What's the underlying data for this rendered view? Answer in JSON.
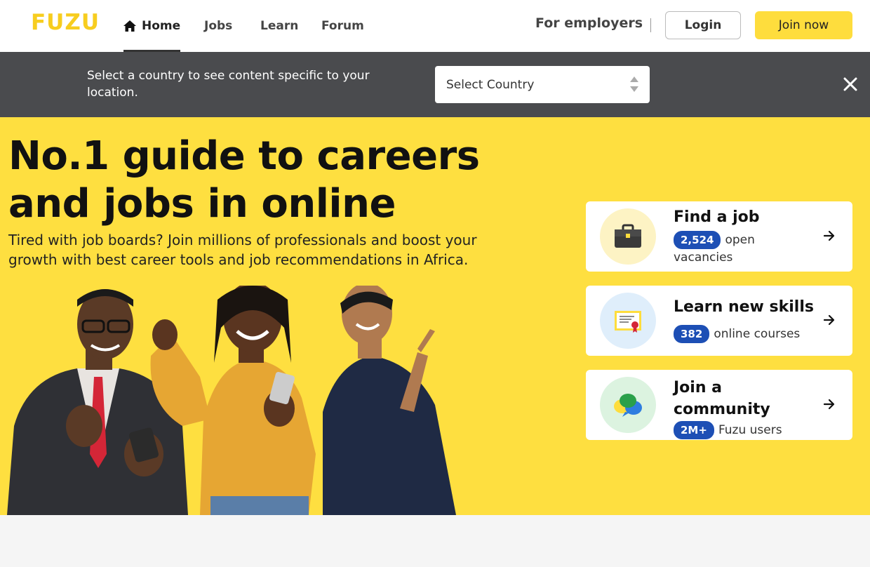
{
  "header": {
    "logo": "FUZU",
    "nav": [
      {
        "label": "Home",
        "active": true
      },
      {
        "label": "Jobs"
      },
      {
        "label": "Learn"
      },
      {
        "label": "Forum"
      }
    ],
    "employers_label": "For employers",
    "login_label": "Login",
    "join_label": "Join now"
  },
  "country_bar": {
    "message": "Select a country to see content specific to your location.",
    "select_value": "Select Country"
  },
  "hero": {
    "title": "No.1 guide to careers and jobs in online",
    "subtitle": "Tired with job boards? Join millions of professionals and boost your growth with best career tools and job recommendations in Africa."
  },
  "cards": [
    {
      "title": "Find a job",
      "badge": "2,524",
      "text": "open vacancies",
      "icon": "briefcase-icon"
    },
    {
      "title": "Learn new skills",
      "badge": "382",
      "text": "online courses",
      "icon": "certificate-icon"
    },
    {
      "title": "Join a community",
      "badge": "2M+",
      "text": "Fuzu users",
      "icon": "chat-bubbles-icon"
    }
  ],
  "colors": {
    "brand_yellow": "#fedf40",
    "badge_blue": "#1d4fb5",
    "country_bar": "#4a4b4e"
  }
}
